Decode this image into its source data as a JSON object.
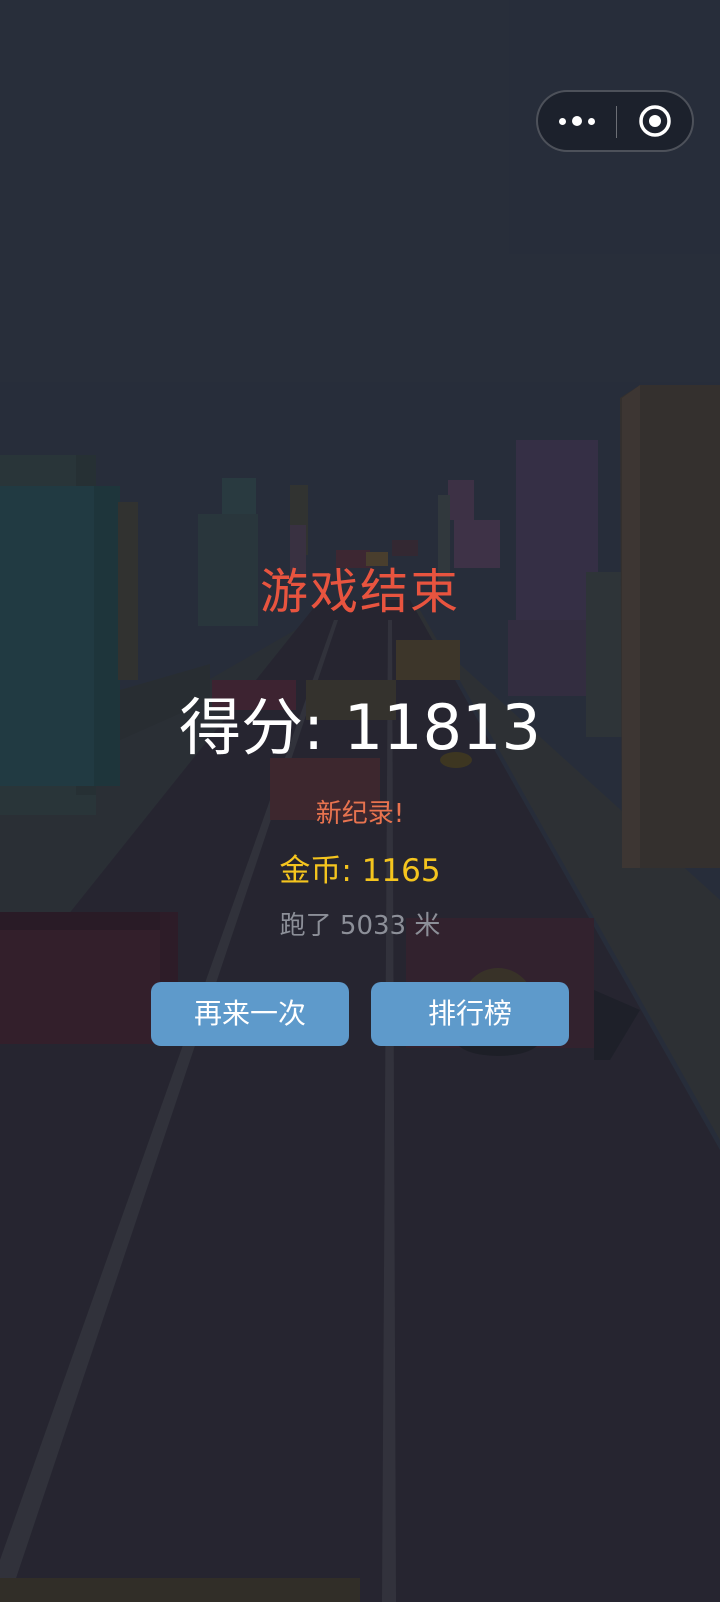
{
  "capsule": {
    "more_icon": "three-dots-icon",
    "close_icon": "target-circle-icon"
  },
  "game_over": {
    "title": "游戏结束",
    "score_label": "得分:",
    "score_value": "11813",
    "new_record": "新纪录!",
    "coins_label": "金币:",
    "coins_value": "1165",
    "distance_prefix": "跑了",
    "distance_value": "5033",
    "distance_unit": "米"
  },
  "buttons": {
    "retry_label": "再来一次",
    "leaderboard_label": "排行榜"
  },
  "colors": {
    "title": "#e8543f",
    "new_record": "#e8734f",
    "coins": "#f5c51e",
    "distance": "#8c8f98",
    "button_bg": "#5e9acb",
    "sky": "#2c3340",
    "road": "#2a2833"
  }
}
